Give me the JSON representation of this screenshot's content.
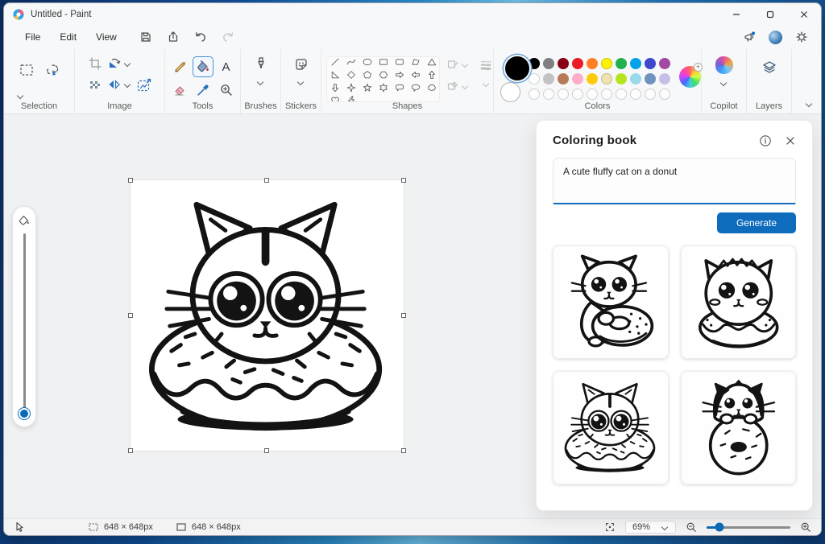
{
  "window": {
    "title": "Untitled - Paint"
  },
  "menu": {
    "items": [
      "File",
      "Edit",
      "View"
    ]
  },
  "ribbon": {
    "groups": {
      "selection": "Selection",
      "image": "Image",
      "tools": "Tools",
      "brushes": "Brushes",
      "stickers": "Stickers",
      "shapes": "Shapes",
      "colors": "Colors",
      "copilot": "Copilot",
      "layers": "Layers"
    },
    "tools": {
      "text_tool_glyph": "A"
    },
    "shapes": {
      "items": [
        "line",
        "curve",
        "oval",
        "rectangle",
        "rounded-rectangle",
        "polygon",
        "triangle",
        "right-triangle",
        "diamond",
        "pentagon",
        "hexagon",
        "arrow-right",
        "arrow-left",
        "arrow-up",
        "arrow-down",
        "star-4",
        "star-5",
        "star-6",
        "speech-rounded",
        "speech-oval",
        "speech-cloud",
        "heart",
        "lightning"
      ]
    },
    "colors": {
      "foreground": "#000000",
      "background": "#ffffff",
      "accent": "#0f6cbd",
      "row1": [
        "#000000",
        "#7f7f7f",
        "#880015",
        "#ed1c24",
        "#ff7f27",
        "#fff200",
        "#22b14c",
        "#00a2e8",
        "#3f48cc",
        "#a349a4"
      ],
      "row2": [
        "#ffffff",
        "#c3c3c3",
        "#b97a57",
        "#ffaec9",
        "#ffc90e",
        "#efe4b0",
        "#b5e61d",
        "#99d9ea",
        "#7092be",
        "#c8bfe7"
      ],
      "empty_slots": 10
    }
  },
  "panel": {
    "title": "Coloring book",
    "prompt": "A cute fluffy cat on a donut",
    "generate_label": "Generate",
    "thumbnails": [
      {
        "label": "cat hugging a donut"
      },
      {
        "label": "fluffy cat sitting on a donut"
      },
      {
        "label": "cat inside a donut"
      },
      {
        "label": "black and white cat behind a donut"
      }
    ]
  },
  "statusbar": {
    "selection_size": "648 × 648px",
    "canvas_size": "648 × 648px",
    "zoom": "69%"
  }
}
